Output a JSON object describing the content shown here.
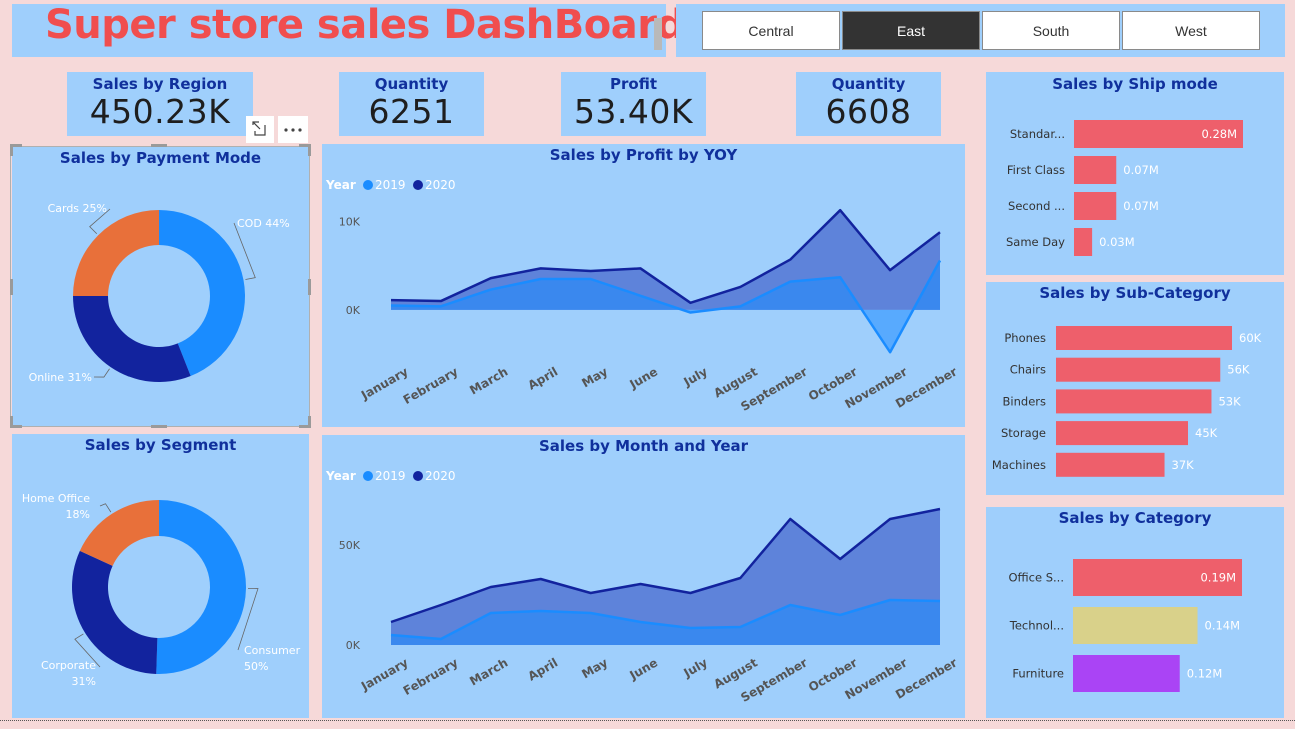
{
  "header": {
    "title": "Super store sales DashBoard",
    "slicers": [
      {
        "label": "Central",
        "active": false
      },
      {
        "label": "East",
        "active": true
      },
      {
        "label": "South",
        "active": false
      },
      {
        "label": "West",
        "active": false
      }
    ]
  },
  "kpis": {
    "sales_by_region": {
      "label": "Sales by Region",
      "value": "450.23K"
    },
    "quantity_1": {
      "label": "Quantity",
      "value": "6251"
    },
    "profit": {
      "label": "Profit",
      "value": "53.40K"
    },
    "quantity_2": {
      "label": "Quantity",
      "value": "6608"
    }
  },
  "colors": {
    "panel": "#9fcffc",
    "bar_red": "#ee5f6b",
    "series_2019": "#1a8cff",
    "series_2020": "#12239e",
    "orange": "#e8703a",
    "yellow": "#d9d18a",
    "purple": "#aa44f5",
    "title_red": "#f04e4e"
  },
  "visual_header_icons": [
    "filter-icon",
    "focus-mode-icon",
    "more-options-icon"
  ],
  "charts": {
    "payment_mode": {
      "title": "Sales by Payment Mode",
      "chart_data": {
        "type": "pie",
        "variant": "donut",
        "title": "Sales by Payment Mode",
        "slices": [
          {
            "name": "COD",
            "label": "COD 44%",
            "value": 44,
            "color": "#1a8cff"
          },
          {
            "name": "Online",
            "label": "Online 31%",
            "value": 31,
            "color": "#12239e"
          },
          {
            "name": "Cards",
            "label": "Cards 25%",
            "value": 25,
            "color": "#e8703a"
          }
        ]
      }
    },
    "segment": {
      "title": "Sales by Segment",
      "chart_data": {
        "type": "pie",
        "variant": "donut",
        "title": "Sales by Segment",
        "slices": [
          {
            "name": "Consumer",
            "label": "Consumer",
            "pct": "50%",
            "value": 50,
            "color": "#1a8cff"
          },
          {
            "name": "Corporate",
            "label": "Corporate",
            "pct": "31%",
            "value": 31,
            "color": "#12239e"
          },
          {
            "name": "Home Office",
            "label": "Home Office",
            "pct": "18%",
            "value": 18,
            "color": "#e8703a"
          }
        ]
      }
    },
    "profit_yoy": {
      "title": "Sales by Profit by YOY",
      "legend_title": "Year",
      "chart_data": {
        "type": "area",
        "title": "Sales by Profit by YOY",
        "categories": [
          "January",
          "February",
          "March",
          "April",
          "May",
          "June",
          "July",
          "August",
          "September",
          "October",
          "November",
          "December"
        ],
        "series": [
          {
            "name": "2019",
            "color": "#1a8cff",
            "values": [
              500,
              400,
              2300,
              3500,
              3500,
              1600,
              -300,
              400,
              3200,
              3700,
              -4800,
              5600
            ]
          },
          {
            "name": "2020",
            "color": "#12239e",
            "values": [
              1100,
              1000,
              3600,
              4700,
              4400,
              4700,
              800,
              2600,
              5700,
              11300,
              4500,
              8800
            ]
          }
        ],
        "yticks": [
          {
            "value": 0,
            "label": "0K"
          },
          {
            "value": 10000,
            "label": "10K"
          }
        ],
        "ylim": [
          -5000,
          12000
        ],
        "legend": "top-left"
      }
    },
    "month_year": {
      "title": "Sales by Month and Year",
      "legend_title": "Year",
      "chart_data": {
        "type": "area",
        "title": "Sales by Month and Year",
        "categories": [
          "January",
          "February",
          "March",
          "April",
          "May",
          "June",
          "July",
          "August",
          "September",
          "October",
          "November",
          "December"
        ],
        "series": [
          {
            "name": "2019",
            "color": "#1a8cff",
            "values": [
              5000,
              3000,
              16000,
              17000,
              16000,
              11500,
              8500,
              9000,
              20000,
              15000,
              22500,
              22000
            ]
          },
          {
            "name": "2020",
            "color": "#12239e",
            "values": [
              11500,
              20000,
              29000,
              33000,
              26000,
              30500,
              26000,
              33500,
              63000,
              43000,
              63000,
              68000
            ]
          }
        ],
        "yticks": [
          {
            "value": 0,
            "label": "0K"
          },
          {
            "value": 50000,
            "label": "50K"
          }
        ],
        "ylim": [
          0,
          75000
        ],
        "legend": "top-left"
      }
    },
    "ship_mode": {
      "title": "Sales by Ship mode",
      "chart_data": {
        "type": "bar",
        "orientation": "horizontal",
        "title": "Sales by Ship mode",
        "categories": [
          "Standar...",
          "First Class",
          "Second ...",
          "Same Day"
        ],
        "values": [
          0.28,
          0.07,
          0.07,
          0.03
        ],
        "labels": [
          "0.28M",
          "0.07M",
          "0.07M",
          "0.03M"
        ],
        "unit": "M",
        "color": "#ee5f6b"
      }
    },
    "sub_category": {
      "title": "Sales by Sub-Category",
      "chart_data": {
        "type": "bar",
        "orientation": "horizontal",
        "title": "Sales by Sub-Category",
        "categories": [
          "Phones",
          "Chairs",
          "Binders",
          "Storage",
          "Machines"
        ],
        "values": [
          60,
          56,
          53,
          45,
          37
        ],
        "labels": [
          "60K",
          "56K",
          "53K",
          "45K",
          "37K"
        ],
        "unit": "K",
        "color": "#ee5f6b"
      }
    },
    "category": {
      "title": "Sales by Category",
      "chart_data": {
        "type": "bar",
        "orientation": "horizontal",
        "title": "Sales by Category",
        "categories": [
          "Office S...",
          "Technol...",
          "Furniture"
        ],
        "values": [
          0.19,
          0.14,
          0.12
        ],
        "labels": [
          "0.19M",
          "0.14M",
          "0.12M"
        ],
        "unit": "M",
        "colors": [
          "#ee5f6b",
          "#d9d18a",
          "#aa44f5"
        ]
      }
    }
  }
}
